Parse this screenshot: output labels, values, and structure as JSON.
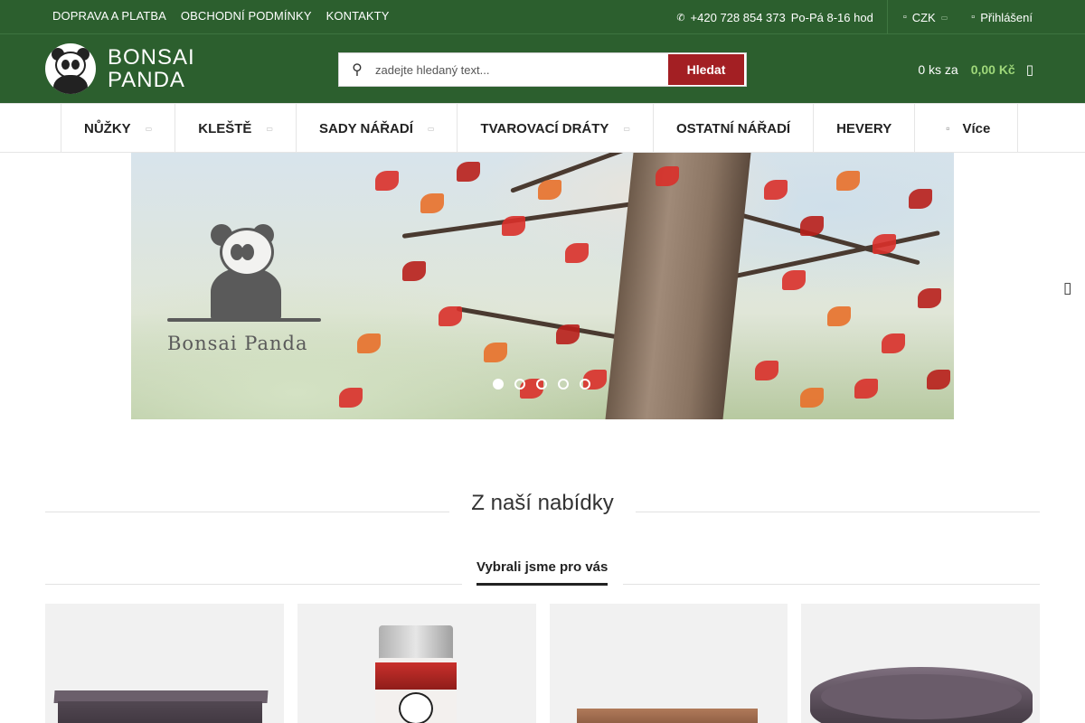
{
  "topbar": {
    "links": [
      "DOPRAVA A PLATBA",
      "OBCHODNÍ PODMÍNKY",
      "KONTAKTY"
    ],
    "phone": "+420 728 854 373",
    "hours": "Po-Pá 8-16 hod",
    "currency": "CZK",
    "login": "Přihlášení"
  },
  "header": {
    "logo_line1": "BONSAI",
    "logo_line2": "PANDA",
    "search_placeholder": "zadejte hledaný text...",
    "search_button": "Hledat",
    "cart_qty": "0 ks za",
    "cart_price": "0,00 Kč"
  },
  "nav": {
    "items": [
      {
        "label": "NŮŽKY",
        "has_sub": true
      },
      {
        "label": "KLEŠTĚ",
        "has_sub": true
      },
      {
        "label": "SADY NÁŘADÍ",
        "has_sub": true
      },
      {
        "label": "TVAROVACÍ DRÁTY",
        "has_sub": true
      },
      {
        "label": "OSTATNÍ NÁŘADÍ",
        "has_sub": false
      },
      {
        "label": "HEVERY",
        "has_sub": false
      }
    ],
    "more_label": "Více"
  },
  "banner": {
    "logo_text": "Bonsai Panda",
    "slide_count": 5,
    "active_slide": 1
  },
  "section": {
    "title": "Z naší nabídky",
    "tab_active": "Vybrali jsme pro vás"
  },
  "products": [
    {
      "name": "rectangular-pot"
    },
    {
      "name": "bottle"
    },
    {
      "name": "clay-pot"
    },
    {
      "name": "oval-pot"
    }
  ],
  "colors": {
    "header_green": "#2c5f2e",
    "accent_red": "#a31f23",
    "price_green": "#9fd87a"
  }
}
